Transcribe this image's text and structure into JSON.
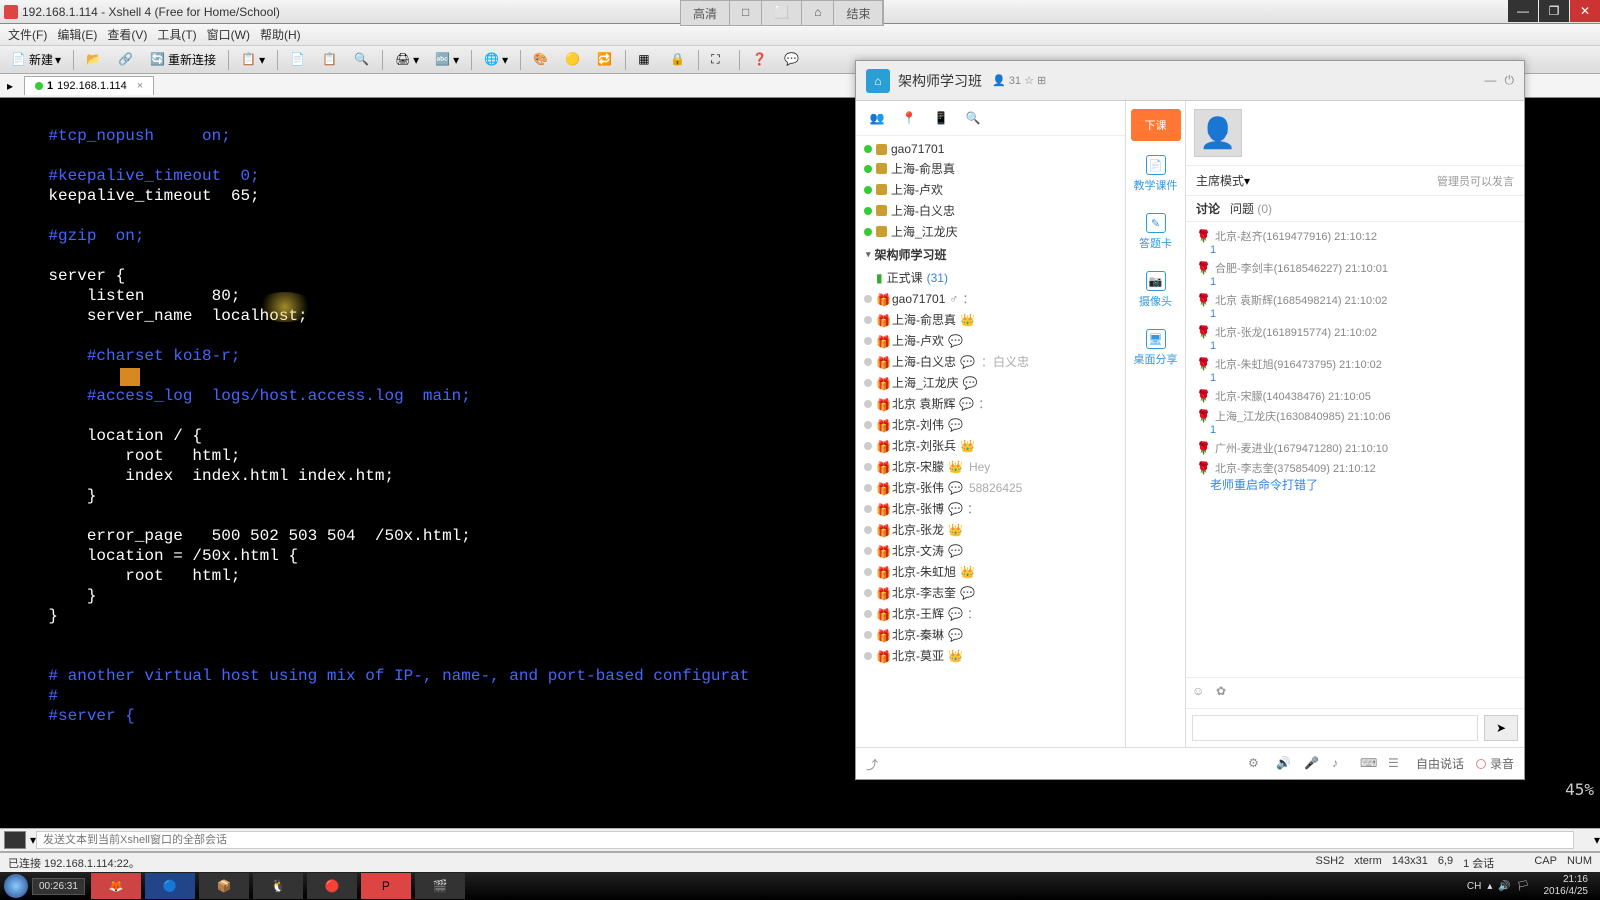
{
  "window": {
    "title": "192.168.1.114 - Xshell 4 (Free for Home/School)"
  },
  "topcenter": {
    "b1": "高清",
    "b2": "□",
    "b3": "⬜",
    "b4": "⌂",
    "b5": "结束"
  },
  "menu": {
    "file": "文件(F)",
    "edit": "编辑(E)",
    "view": "查看(V)",
    "tool": "工具(T)",
    "window": "窗口(W)",
    "help": "帮助(H)"
  },
  "toolbar": {
    "new": "新建",
    "reconnect": "重新连接"
  },
  "tab": {
    "index": "1",
    "label": "192.168.1.114"
  },
  "terminal": {
    "l1": "    #tcp_nopush     on;",
    "l2": "",
    "l3": "    #keepalive_timeout  0;",
    "l4": "    keepalive_timeout  65;",
    "l5": "",
    "l6": "    #gzip  on;",
    "l7": "",
    "l8": "    server {",
    "l9": "        listen       80;",
    "l10": "        server_name  localhost;",
    "l11": "",
    "l12": "        #charset koi8-r;",
    "l13": "",
    "l14": "        #access_log  logs/host.access.log  main;",
    "l15": "",
    "l16": "        location / {",
    "l17": "            root   html;",
    "l18": "            index  index.html index.htm;",
    "l19": "        }",
    "l20": "",
    "l21": "        error_page   500 502 503 504  /50x.html;",
    "l22": "        location = /50x.html {",
    "l23": "            root   html;",
    "l24": "        }",
    "l25": "    }",
    "l26": "",
    "l27": "",
    "l28": "    # another virtual host using mix of IP-, name-, and port-based configurat",
    "l29": "    #",
    "l30": "    #server {"
  },
  "zoom": "45%",
  "chat": {
    "title": "架构师学习班",
    "count": "31",
    "primary_btn": "下课",
    "mid": {
      "b1": "教学课件",
      "b2": "答题卡",
      "b3": "摄像头",
      "b4": "桌面分享"
    },
    "top_group": "架构师学习班",
    "sub_group": "正式课",
    "sub_count": "(31)",
    "speakers": [
      {
        "name": "gao71701"
      },
      {
        "name": "上海-俞思真"
      },
      {
        "name": "上海-卢欢"
      },
      {
        "name": "上海-白义忠"
      },
      {
        "name": "上海_江龙庆"
      }
    ],
    "members": [
      {
        "name": "gao71701",
        "extra": "：",
        "badge": true
      },
      {
        "name": "上海-俞思真",
        "crown": true
      },
      {
        "name": "上海-卢欢",
        "q": true
      },
      {
        "name": "上海-白义忠",
        "q": true,
        "extra2": "：白义忠"
      },
      {
        "name": "上海_江龙庆",
        "q": true
      },
      {
        "name": "北京 袁斯辉",
        "q": true,
        "extra": "："
      },
      {
        "name": "北京-刘伟",
        "q": true
      },
      {
        "name": "北京-刘张兵",
        "crown": true
      },
      {
        "name": "北京-宋朦",
        "crown": true,
        "extra2": "Hey"
      },
      {
        "name": "北京-张伟",
        "q": true,
        "extra2": "58826425"
      },
      {
        "name": "北京-张博",
        "q": true,
        "extra": "："
      },
      {
        "name": "北京-张龙",
        "crown": true
      },
      {
        "name": "北京-文涛",
        "q": true
      },
      {
        "name": "北京-朱虹旭",
        "crown": true
      },
      {
        "name": "北京-李志奎",
        "q": true
      },
      {
        "name": "北京-王辉",
        "q": true,
        "extra": "："
      },
      {
        "name": "北京-秦琳",
        "q": true
      },
      {
        "name": "北京-莫亚",
        "crown": true
      }
    ],
    "mode": "主席模式",
    "mode_right": "管理员可以发言",
    "tabs": {
      "t1": "讨论",
      "t2": "问题",
      "t2c": "(0)"
    },
    "messages": [
      {
        "meta": "北京-赵齐(1619477916) 21:10:12",
        "count": "1"
      },
      {
        "meta": "合肥-李剑丰(1618546227) 21:10:01",
        "count": "1"
      },
      {
        "meta": "北京 袁斯辉(1685498214) 21:10:02",
        "count": "1"
      },
      {
        "meta": "北京-张龙(1618915774) 21:10:02",
        "count": "1"
      },
      {
        "meta": "北京-朱虹旭(916473795) 21:10:02",
        "count": "1"
      },
      {
        "meta": "北京-宋朦(140438476) 21:10:05",
        "count": ""
      },
      {
        "meta": "上海_江龙庆(1630840985) 21:10:06",
        "count": "1"
      },
      {
        "meta": "广州-麦进业(1679471280) 21:10:10",
        "count": ""
      },
      {
        "meta": "北京-李志奎(37585409) 21:10:12",
        "text": "老师重启命令打错了"
      }
    ],
    "footer": {
      "free": "自由说话",
      "rec": "录音"
    }
  },
  "bottom_input": {
    "placeholder": "发送文本到当前Xshell窗口的全部会话"
  },
  "statusbar": {
    "left": "已连接 192.168.1.114:22。",
    "ssh": "SSH2",
    "term": "xterm",
    "size": "143x31",
    "pos": "6,9",
    "sess": "1 会话",
    "cap": "CAP",
    "num": "NUM"
  },
  "taskbar": {
    "elapsed": "00:26:31",
    "ime": "CH",
    "time": "21:16",
    "date": "2016/4/25"
  }
}
